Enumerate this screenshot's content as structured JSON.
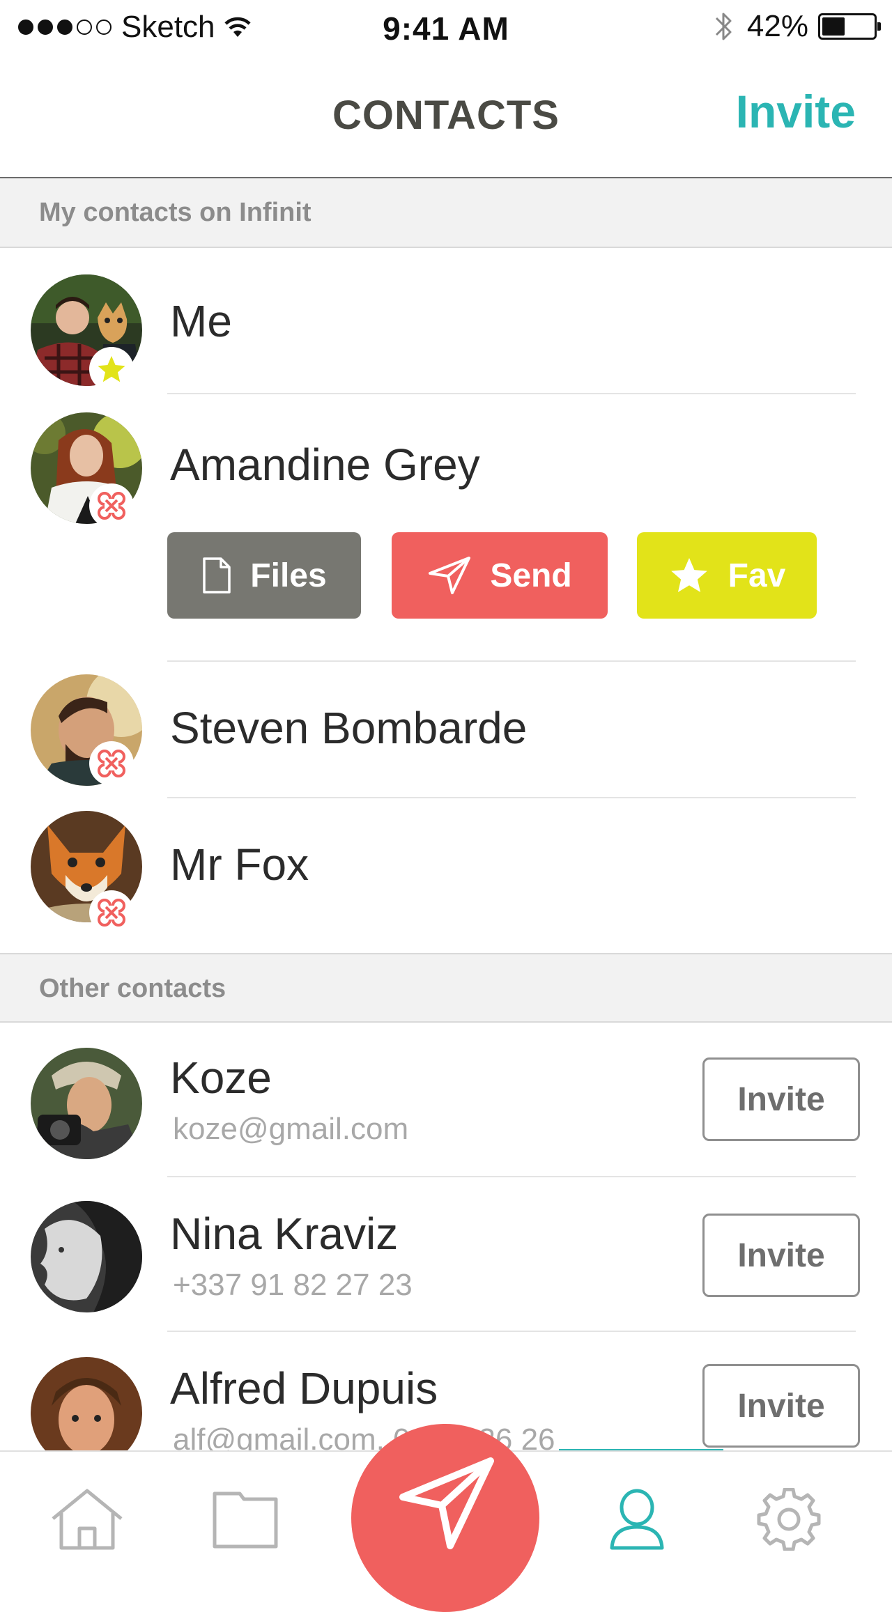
{
  "status_bar": {
    "carrier": "Sketch",
    "time": "9:41 AM",
    "battery": "42%",
    "battery_level": 0.42
  },
  "header": {
    "title": "CONTACTS",
    "invite_label": "Invite"
  },
  "sections": {
    "infinit": "My contacts on Infinit",
    "other": "Other contacts"
  },
  "infinit_contacts": [
    {
      "name": "Me",
      "badge": "star-icon"
    },
    {
      "name": "Amandine Grey",
      "badge": "infinit-logo-icon"
    },
    {
      "name": "Steven Bombarde",
      "badge": "infinit-logo-icon"
    },
    {
      "name": "Mr Fox",
      "badge": "infinit-logo-icon"
    }
  ],
  "actions": {
    "files": "Files",
    "send": "Send",
    "fav": "Fav"
  },
  "other_contacts": [
    {
      "name": "Koze",
      "detail": "koze@gmail.com",
      "button": "Invite"
    },
    {
      "name": "Nina Kraviz",
      "detail": "+337 91 82 27 23",
      "button": "Invite"
    },
    {
      "name": "Alfred Dupuis",
      "detail": "alf@gmail.com, 06 93 26 26",
      "button": "Invite"
    }
  ],
  "colors": {
    "accent": "#2bb5b3",
    "send": "#f0605e",
    "fav": "#e2e319",
    "files": "#777771"
  },
  "tabbar": {
    "tabs": [
      "home-icon",
      "folder-icon",
      "send-icon",
      "contacts-icon",
      "settings-icon"
    ],
    "active": "contacts-icon"
  }
}
